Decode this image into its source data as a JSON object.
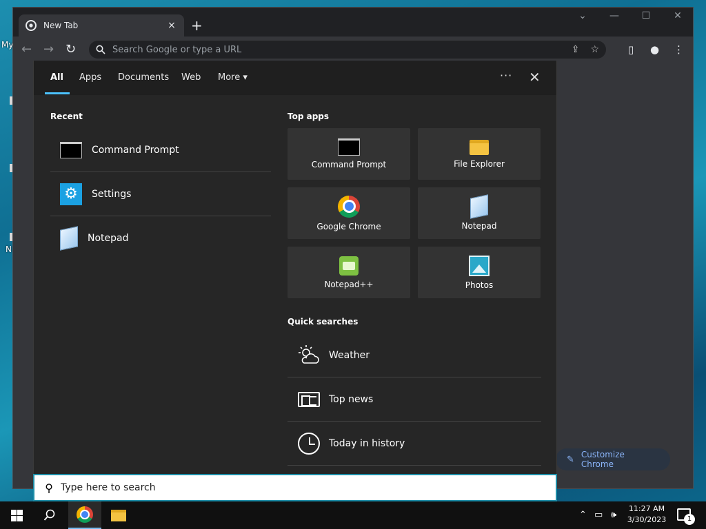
{
  "desktop": {
    "labels": [
      "My",
      "N"
    ]
  },
  "chrome": {
    "tab_title": "New Tab",
    "tab_close": "×",
    "new_tab": "+",
    "omnibox_placeholder": "Search Google or type a URL",
    "customize_label": "Customize Chrome"
  },
  "search_panel": {
    "tabs": [
      "All",
      "Apps",
      "Documents",
      "Web",
      "More"
    ],
    "more_arrow": "▾",
    "dots": "···",
    "close": "✕",
    "recent_title": "Recent",
    "recent_items": [
      {
        "label": "Command Prompt",
        "icon": "command-prompt-icon"
      },
      {
        "label": "Settings",
        "icon": "settings-gear-icon"
      },
      {
        "label": "Notepad",
        "icon": "notepad-icon"
      }
    ],
    "top_apps_title": "Top apps",
    "top_apps": [
      {
        "label": "Command Prompt",
        "icon": "command-prompt-icon"
      },
      {
        "label": "File Explorer",
        "icon": "folder-icon"
      },
      {
        "label": "Google Chrome",
        "icon": "chrome-icon"
      },
      {
        "label": "Notepad",
        "icon": "notepad-icon"
      },
      {
        "label": "Notepad++",
        "icon": "notepad-plus-plus-icon"
      },
      {
        "label": "Photos",
        "icon": "photos-icon"
      }
    ],
    "quick_searches_title": "Quick searches",
    "quick_searches": [
      {
        "label": "Weather",
        "icon": "weather-icon"
      },
      {
        "label": "Top news",
        "icon": "news-icon"
      },
      {
        "label": "Today in history",
        "icon": "clock-icon"
      }
    ],
    "search_placeholder": "Type here to search"
  },
  "taskbar": {
    "time": "11:27 AM",
    "date": "3/30/2023",
    "notification_count": "1"
  },
  "colors": {
    "accent": "#4cc2ff",
    "search_border": "#1e8ea8",
    "chrome_link": "#8ab4f8"
  }
}
